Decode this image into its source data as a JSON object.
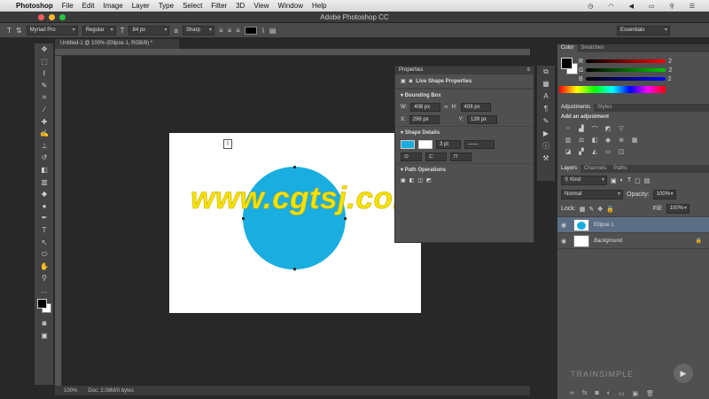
{
  "menubar": {
    "app": "Photoshop",
    "items": [
      "File",
      "Edit",
      "Image",
      "Layer",
      "Type",
      "Select",
      "Filter",
      "3D",
      "View",
      "Window",
      "Help"
    ],
    "clock": "⏏"
  },
  "window": {
    "title": "Adobe Photoshop CC"
  },
  "options": {
    "font_family": "Myriad Pro",
    "font_style": "Regular",
    "font_size": "84 px",
    "antialias": "Sharp",
    "workspace": "Essentials"
  },
  "document": {
    "tab": "Untitled-1 @ 100% (Ellipse 1, RGB/8) *",
    "zoom": "100%",
    "doc_info": "Doc: 2.08M/0 bytes"
  },
  "watermark": {
    "text": "www.cgtsj.com"
  },
  "properties": {
    "title": "Properties",
    "subtitle": "Live Shape Properties",
    "bounding_box": "Bounding Box",
    "w_label": "W:",
    "w_value": "408 px",
    "h_label": "H:",
    "h_value": "408 px",
    "x_label": "X:",
    "x_value": "296 px",
    "y_label": "Y:",
    "y_value": "139 px",
    "shape_details": "Shape Details",
    "stroke_width": "3 pt",
    "path_ops": "Path Operations"
  },
  "color_panel": {
    "tabs": [
      "Color",
      "Swatches"
    ],
    "r_label": "R",
    "r_value": "2",
    "g_label": "G",
    "g_value": "2",
    "b_label": "B",
    "b_value": "2"
  },
  "adjustments": {
    "tabs": [
      "Adjustments",
      "Styles"
    ],
    "add_label": "Add an adjustment"
  },
  "layers": {
    "tabs": [
      "Layers",
      "Channels",
      "Paths"
    ],
    "kind": "Kind",
    "blend": "Normal",
    "opacity_label": "Opacity:",
    "opacity": "100%",
    "lock_label": "Lock:",
    "fill_label": "Fill:",
    "fill": "100%",
    "items": [
      {
        "name": "Ellipse 1"
      },
      {
        "name": "Background"
      }
    ]
  },
  "brand": {
    "text": "TRAINSIMPLE"
  },
  "colors": {
    "shape": "#1aaee0",
    "watermark": "#f7e200"
  }
}
